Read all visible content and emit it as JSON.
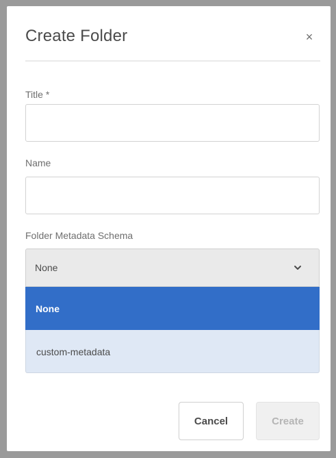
{
  "dialog": {
    "title": "Create Folder",
    "close_glyph": "×"
  },
  "fields": {
    "title_label": "Title *",
    "title_value": "",
    "name_label": "Name",
    "name_value": "",
    "schema_label": "Folder Metadata Schema",
    "schema_selected": "None"
  },
  "dropdown": {
    "options": [
      {
        "label": "None",
        "selected": true
      },
      {
        "label": "custom-metadata",
        "selected": false
      }
    ]
  },
  "buttons": {
    "cancel_label": "Cancel",
    "create_label": "Create",
    "create_enabled": false
  },
  "icons": {
    "close": "close-icon",
    "chevron": "chevron-down-icon"
  },
  "colors": {
    "accent": "#326ec8",
    "option_highlight": "#dfe8f5"
  }
}
